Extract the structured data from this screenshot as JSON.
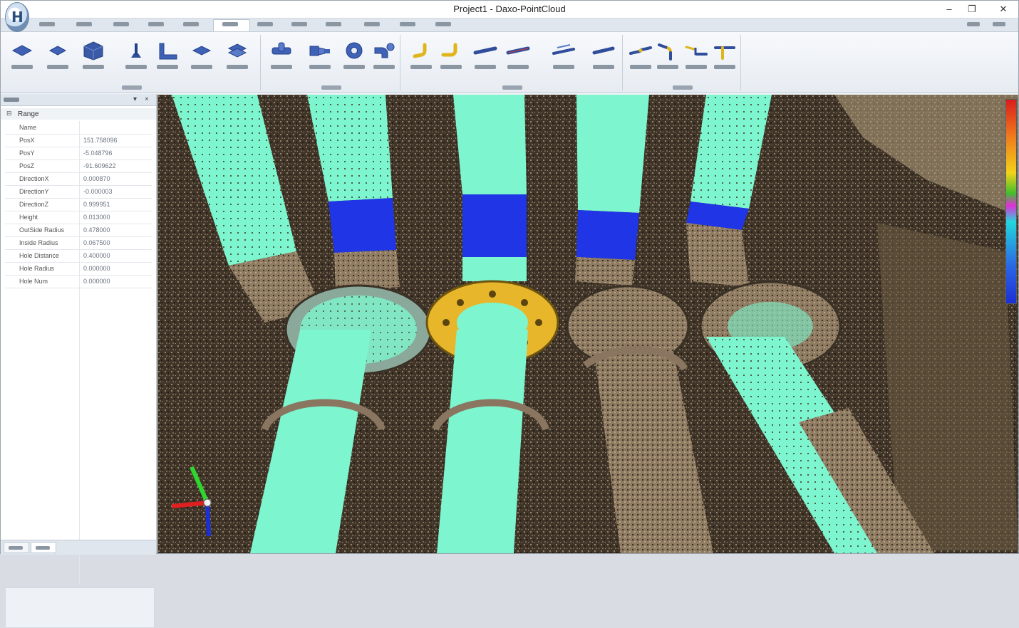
{
  "window": {
    "title": "Project1 - Daxo-PointCloud",
    "controls": [
      "–",
      "❐",
      "✕"
    ]
  },
  "tabs": {
    "items": [
      "",
      "",
      "",
      "",
      "",
      "",
      "",
      "",
      "",
      "",
      "",
      ""
    ],
    "active_index": 7,
    "right_menu": [
      "",
      ""
    ]
  },
  "ribbon": {
    "groups": [
      {
        "label": "",
        "buttons": [
          "",
          "",
          "",
          "",
          "",
          "",
          ""
        ]
      },
      {
        "label": "",
        "buttons": [
          "",
          "",
          "",
          ""
        ]
      },
      {
        "label": "",
        "buttons": [
          "",
          "",
          "",
          "",
          "",
          ""
        ]
      },
      {
        "label": "",
        "buttons": [
          "",
          "",
          "",
          ""
        ]
      }
    ]
  },
  "properties": {
    "panel_title": "",
    "category": "Range",
    "rows": [
      {
        "name": "Name",
        "value": ""
      },
      {
        "name": "PosX",
        "value": "151.758096"
      },
      {
        "name": "PosY",
        "value": "-5.048796"
      },
      {
        "name": "PosZ",
        "value": "-91.609622"
      },
      {
        "name": "DirectionX",
        "value": "0.000870"
      },
      {
        "name": "DirectionY",
        "value": "-0.000003"
      },
      {
        "name": "DirectionZ",
        "value": "0.999951"
      },
      {
        "name": "Height",
        "value": "0.013000"
      },
      {
        "name": "OutSide Radius",
        "value": "0.478000"
      },
      {
        "name": "Inside Radius",
        "value": "0.067500"
      },
      {
        "name": "Hole Distance",
        "value": "0.400000"
      },
      {
        "name": "Hole Radius",
        "value": "0.000000"
      },
      {
        "name": "Hole Num",
        "value": "0.000000"
      }
    ],
    "bottom_tabs": [
      "",
      ""
    ]
  },
  "viewport": {
    "colors": {
      "fitted_pipe": "#7df5cf",
      "selected_segment": "#1f35e6",
      "selected_flange": "#e8b62a",
      "point_cloud": "#8a7660"
    },
    "colorbar_ticks": [
      "",
      "",
      "",
      "",
      ""
    ],
    "axis_colors": {
      "x": "#e02020",
      "y": "#2fd62f",
      "z": "#1c2fd4"
    }
  }
}
